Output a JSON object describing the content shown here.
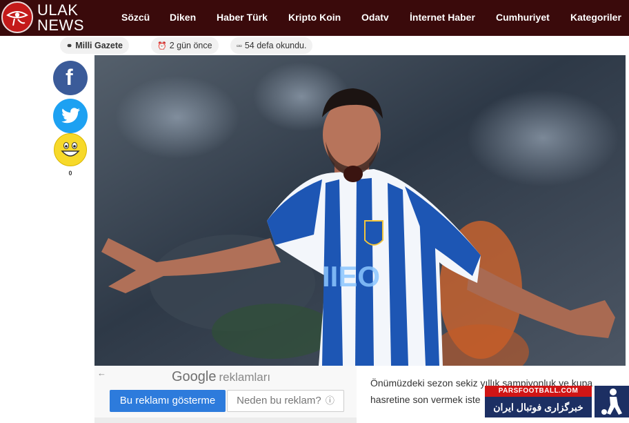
{
  "brand": {
    "line1": "ULAK",
    "line2": "NEWS"
  },
  "nav": [
    {
      "label": "Sözcü"
    },
    {
      "label": "Diken"
    },
    {
      "label": "Haber Türk"
    },
    {
      "label": "Kripto Koin"
    },
    {
      "label": "Odatv"
    },
    {
      "label": "İnternet Haber"
    },
    {
      "label": "Cumhuriyet"
    },
    {
      "label": "Kategoriler"
    }
  ],
  "meta": {
    "source": "Milli Gazete",
    "time": "2 gün önce",
    "reads": "54 defa okundu."
  },
  "share": {
    "facebook_glyph": "f",
    "reaction_count": "0"
  },
  "ad": {
    "back_glyph": "←",
    "google": "Google",
    "label": "reklamları",
    "stop_button": "Bu reklamı gösterme",
    "why_button": "Neden bu reklam?",
    "info_glyph": "ⓘ"
  },
  "article": {
    "line1": "Önümüzdeki sezon sekiz yıllık şampiyonluk ve kupa",
    "line2": "hasretine son vermek iste"
  },
  "watermark": {
    "top": "PARSFOOTBALL.COM",
    "main": "خبرگزاری فوتبال ایران"
  },
  "colors": {
    "topbar": "#3a0a0b",
    "facebook": "#3b5b99",
    "twitter": "#1da1f2",
    "ad_button": "#2d7bdc",
    "jersey_blue": "#1d56b4"
  }
}
